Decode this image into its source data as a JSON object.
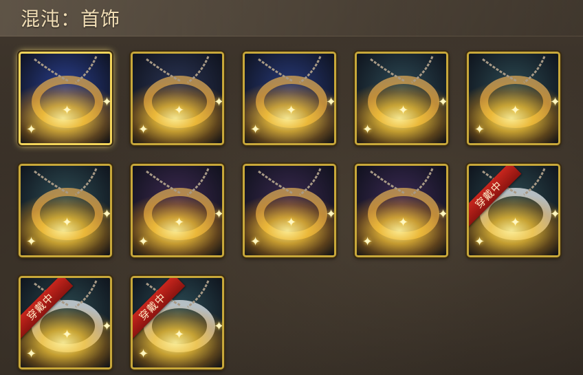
{
  "header": {
    "title": "混沌：首饰"
  },
  "items": [
    {
      "icon": "music-note-pendant-icon",
      "bg": "#2a3f8f",
      "equipped": false,
      "selected": true
    },
    {
      "icon": "music-bracelet-icon",
      "bg": "#2b3555",
      "equipped": false,
      "selected": false
    },
    {
      "icon": "treble-clef-bracelet-icon",
      "bg": "#283a7a",
      "equipped": false,
      "selected": false
    },
    {
      "icon": "hammer-necklace-icon",
      "bg": "#2d4a55",
      "equipped": false,
      "selected": false
    },
    {
      "icon": "feather-bracelet-icon",
      "bg": "#2c4a52",
      "equipped": false,
      "selected": false
    },
    {
      "icon": "crystal-crown-ring-icon",
      "bg": "#2f4e55",
      "equipped": false,
      "selected": false
    },
    {
      "icon": "skull-pendant-icon",
      "bg": "#3e2a52",
      "equipped": false,
      "selected": false
    },
    {
      "icon": "jeweled-bangle-icon",
      "bg": "#3a2950",
      "equipped": false,
      "selected": false
    },
    {
      "icon": "horn-ring-icon",
      "bg": "#3c2a55",
      "equipped": false,
      "selected": false
    },
    {
      "icon": "silver-ring-pendant-icon",
      "bg": "#2c4a50",
      "equipped": true,
      "ribbon": "穿戴中",
      "selected": false
    },
    {
      "icon": "silver-ring-icon",
      "bg": "#2d4c52",
      "equipped": true,
      "ribbon": "穿戴中",
      "selected": false
    },
    {
      "icon": "silver-bracelet-icon",
      "bg": "#2e5059",
      "equipped": true,
      "ribbon": "穿戴中",
      "selected": false
    }
  ],
  "colors": {
    "frame": "#c8a83a",
    "ribbon": "#c8261d",
    "title": "#f0ddb5"
  }
}
